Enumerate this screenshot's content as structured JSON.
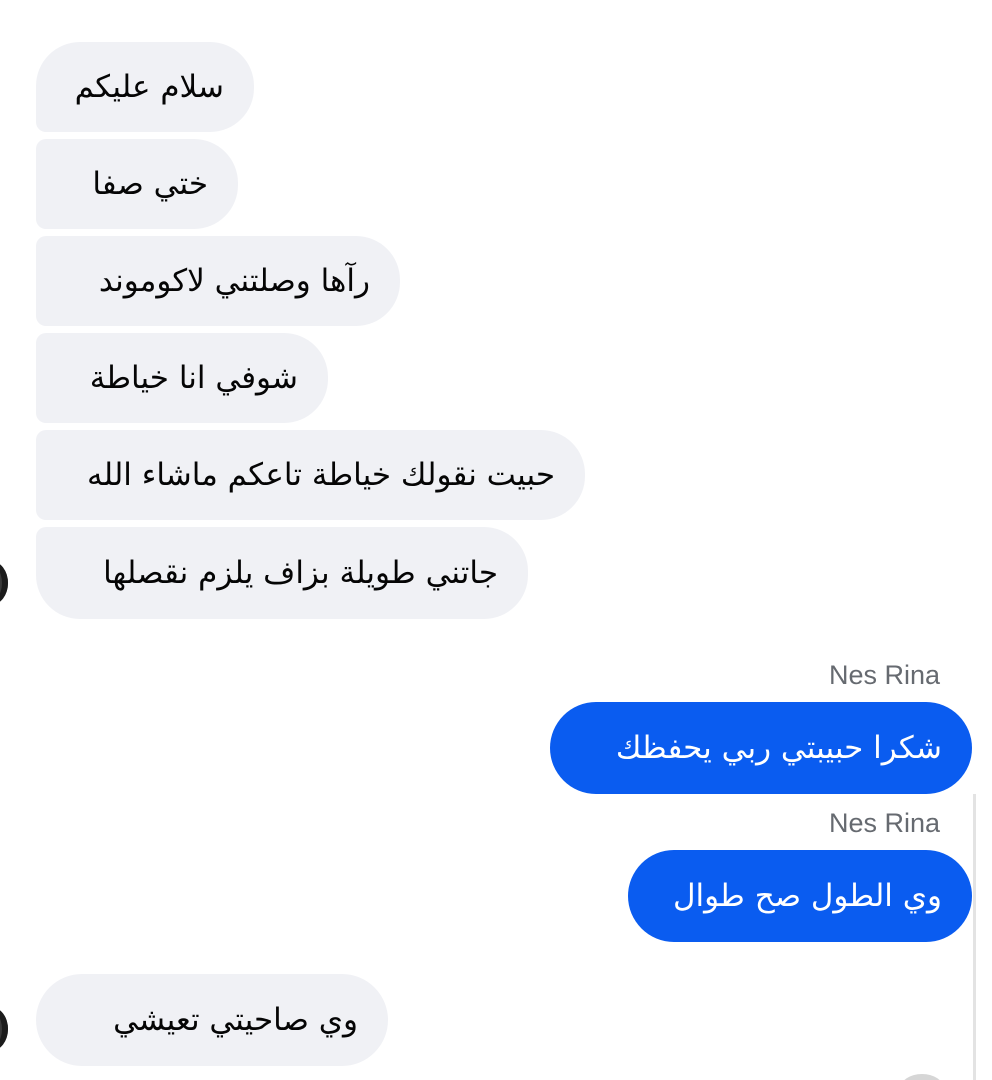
{
  "incoming_group": [
    "سلام عليكم",
    "ختي صفا",
    "رآها وصلتني لاكوموند",
    "شوفي انا خياطة",
    "حبيت نقولك خياطة تاعكم ماشاء الله",
    "جاتني طويلة بزاف يلزم نقصلها"
  ],
  "outgoing": [
    {
      "sender": "Nes Rina",
      "text": "شكرا حبيبتي ربي يحفظك"
    },
    {
      "sender": "Nes Rina",
      "text": "وي الطول صح طوال"
    }
  ],
  "last_incoming": "وي صاحيتي تعيشي",
  "colors": {
    "incoming_bubble": "#f0f1f5",
    "outgoing_bubble": "#0a5cf0",
    "sender_name": "#666a70"
  }
}
